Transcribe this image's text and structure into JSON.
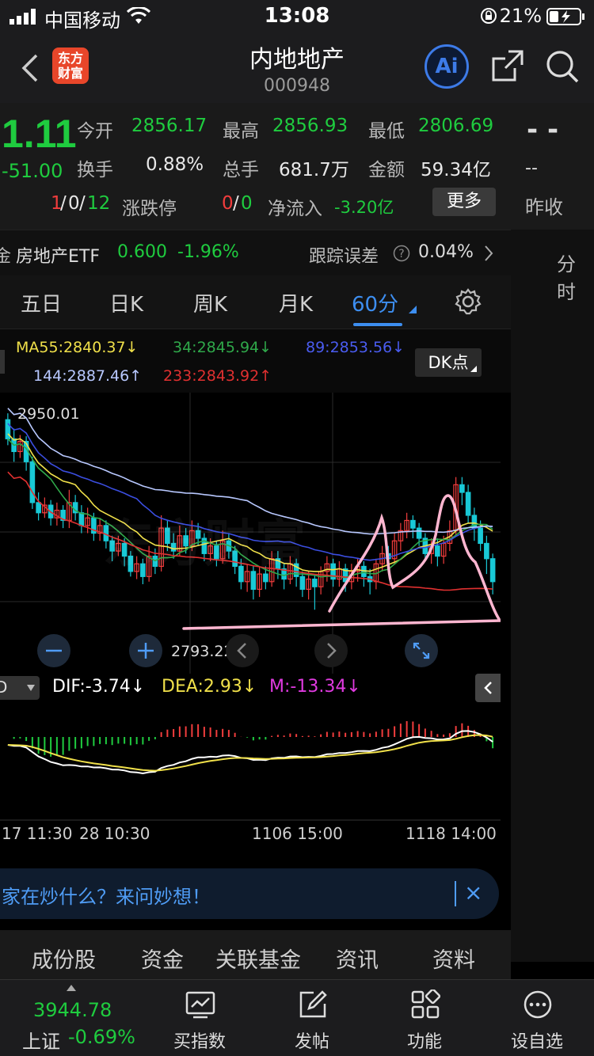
{
  "status_bar": {
    "carrier": "中国移动",
    "time": "13:08",
    "battery": "21%"
  },
  "header": {
    "logo_line1": "东方",
    "logo_line2": "财富",
    "title": "内地地产",
    "code": "000948",
    "ai_label": "Ai"
  },
  "quote": {
    "price": "1.11",
    "change": "-51.00",
    "open_label": "今开",
    "open": "2856.17",
    "high_label": "最高",
    "high": "2856.93",
    "low_label": "最低",
    "low": "2806.69",
    "turnover_label": "换手",
    "turnover": "0.88%",
    "volume_label": "总手",
    "volume": "681.7万",
    "amount_label": "金额",
    "amount": "59.34亿",
    "updown_red": "1",
    "updown_sep1": "/",
    "updown_flat": "0",
    "updown_sep2": "/",
    "updown_green": "12",
    "limit_label": "涨跌停",
    "limit_red": "0",
    "limit_sep": "/",
    "limit_green": "0",
    "netflow_label": "净流入",
    "netflow": "-3.20亿",
    "more_label": "更多",
    "right_dash": "- -",
    "right_dash2": "--",
    "prev_close_label": "昨收"
  },
  "etf": {
    "prefix": "金",
    "name": "房地产ETF",
    "price": "0.600",
    "change": "-1.96%",
    "tracking_label": "跟踪误差",
    "tracking_value": "0.04%",
    "right_label": "分时"
  },
  "tabs": {
    "five_day": "五日",
    "day_k": "日K",
    "week_k": "周K",
    "month_k": "月K",
    "min60": "60分",
    "settings": "设置"
  },
  "ma": {
    "ma55": "MA55:2840.37↓",
    "ma34": "34:2845.94↓",
    "ma89": "89:2853.56↓",
    "ma144": "144:2887.46↑",
    "ma233": "233:2843.92↑",
    "dk_label": "DK点"
  },
  "chart_labels": {
    "high_mark": "2950.01",
    "low_mark": "2793.22",
    "watermark": "东方财富"
  },
  "macd": {
    "dif": "DIF:-3.74↓",
    "dea": "DEA:2.93↓",
    "m": "M:-13.34↓",
    "selector": "D"
  },
  "xaxis": {
    "t1": "17 11:30",
    "t2": "28 10:30",
    "t3": "1106 15:00",
    "t4": "1118 14:00"
  },
  "ask_bar": {
    "text": "家在炒什么？来问妙想！",
    "close": "×"
  },
  "bottom_tabs": {
    "t1": "成份股",
    "t2": "资金",
    "t3": "关联基金",
    "t4": "资讯",
    "t5": "资料"
  },
  "toolbar": {
    "index_value": "3944.78",
    "index_name": "上证",
    "index_change": "-0.69%",
    "buy_index": "买指数",
    "post": "发帖",
    "functions": "功能",
    "custom": "设自选"
  },
  "colors": {
    "up": "#f23d3d",
    "down": "#1fcc3f",
    "accent": "#3d8ef0",
    "ma55": "#f0e04a",
    "ma34": "#2fa84a",
    "ma89": "#3b4ee0",
    "ma144": "#b8c8ff",
    "ma233": "#e03030"
  },
  "chart_data": {
    "type": "candlestick",
    "period": "60分",
    "ylim": [
      2780,
      2960
    ],
    "high_marker": 2950.01,
    "low_marker": 2793.22,
    "x_ticks": [
      "17 11:30",
      "28 10:30",
      "1106 15:00",
      "1118 14:00"
    ],
    "candles": [
      [
        2945,
        2930,
        2950,
        2925
      ],
      [
        2930,
        2920,
        2938,
        2912
      ],
      [
        2920,
        2928,
        2933,
        2915
      ],
      [
        2928,
        2912,
        2932,
        2905
      ],
      [
        2912,
        2880,
        2916,
        2875
      ],
      [
        2880,
        2872,
        2888,
        2866
      ],
      [
        2872,
        2878,
        2884,
        2868
      ],
      [
        2878,
        2868,
        2882,
        2862
      ],
      [
        2868,
        2874,
        2880,
        2862
      ],
      [
        2874,
        2866,
        2878,
        2860
      ],
      [
        2866,
        2880,
        2890,
        2860
      ],
      [
        2880,
        2872,
        2886,
        2866
      ],
      [
        2872,
        2862,
        2878,
        2856
      ],
      [
        2862,
        2868,
        2876,
        2856
      ],
      [
        2868,
        2856,
        2872,
        2850
      ],
      [
        2856,
        2862,
        2868,
        2850
      ],
      [
        2862,
        2850,
        2866,
        2844
      ],
      [
        2850,
        2842,
        2854,
        2834
      ],
      [
        2842,
        2848,
        2854,
        2838
      ],
      [
        2848,
        2838,
        2852,
        2830
      ],
      [
        2838,
        2826,
        2842,
        2822
      ],
      [
        2826,
        2832,
        2838,
        2820
      ],
      [
        2832,
        2822,
        2836,
        2816
      ],
      [
        2822,
        2838,
        2846,
        2818
      ],
      [
        2838,
        2830,
        2844,
        2824
      ],
      [
        2830,
        2860,
        2870,
        2826
      ],
      [
        2860,
        2848,
        2866,
        2842
      ],
      [
        2848,
        2842,
        2856,
        2836
      ],
      [
        2842,
        2854,
        2862,
        2838
      ],
      [
        2854,
        2846,
        2860,
        2840
      ],
      [
        2846,
        2858,
        2866,
        2842
      ],
      [
        2858,
        2852,
        2864,
        2846
      ],
      [
        2852,
        2840,
        2856,
        2834
      ],
      [
        2840,
        2846,
        2852,
        2834
      ],
      [
        2846,
        2836,
        2850,
        2830
      ],
      [
        2836,
        2850,
        2858,
        2832
      ],
      [
        2850,
        2842,
        2856,
        2836
      ],
      [
        2842,
        2830,
        2846,
        2824
      ],
      [
        2830,
        2818,
        2836,
        2812
      ],
      [
        2818,
        2826,
        2832,
        2810
      ],
      [
        2826,
        2812,
        2830,
        2804
      ],
      [
        2812,
        2824,
        2830,
        2806
      ],
      [
        2824,
        2818,
        2830,
        2812
      ],
      [
        2818,
        2836,
        2842,
        2814
      ],
      [
        2836,
        2828,
        2842,
        2820
      ],
      [
        2828,
        2820,
        2832,
        2812
      ],
      [
        2820,
        2832,
        2838,
        2816
      ],
      [
        2832,
        2822,
        2836,
        2814
      ],
      [
        2822,
        2812,
        2826,
        2806
      ],
      [
        2812,
        2820,
        2826,
        2804
      ],
      [
        2820,
        2814,
        2824,
        2796
      ],
      [
        2814,
        2826,
        2830,
        2808
      ],
      [
        2826,
        2832,
        2838,
        2818
      ],
      [
        2832,
        2820,
        2836,
        2814
      ],
      [
        2820,
        2828,
        2834,
        2814
      ],
      [
        2828,
        2818,
        2832,
        2810
      ],
      [
        2818,
        2826,
        2832,
        2812
      ],
      [
        2826,
        2830,
        2836,
        2818
      ],
      [
        2830,
        2822,
        2834,
        2814
      ],
      [
        2822,
        2818,
        2828,
        2808
      ],
      [
        2818,
        2832,
        2836,
        2812
      ],
      [
        2832,
        2840,
        2846,
        2826
      ],
      [
        2840,
        2836,
        2846,
        2828
      ],
      [
        2836,
        2850,
        2856,
        2832
      ],
      [
        2850,
        2858,
        2864,
        2842
      ],
      [
        2858,
        2866,
        2872,
        2852
      ],
      [
        2866,
        2860,
        2870,
        2852
      ],
      [
        2860,
        2852,
        2864,
        2846
      ],
      [
        2852,
        2840,
        2856,
        2834
      ],
      [
        2840,
        2846,
        2852,
        2832
      ],
      [
        2846,
        2838,
        2852,
        2830
      ],
      [
        2838,
        2848,
        2854,
        2832
      ],
      [
        2848,
        2858,
        2866,
        2842
      ],
      [
        2858,
        2894,
        2900,
        2854
      ],
      [
        2894,
        2888,
        2900,
        2878
      ],
      [
        2888,
        2870,
        2894,
        2864
      ],
      [
        2870,
        2860,
        2876,
        2850
      ],
      [
        2860,
        2848,
        2866,
        2842
      ],
      [
        2848,
        2836,
        2854,
        2824
      ],
      [
        2836,
        2818,
        2840,
        2808
      ]
    ]
  }
}
